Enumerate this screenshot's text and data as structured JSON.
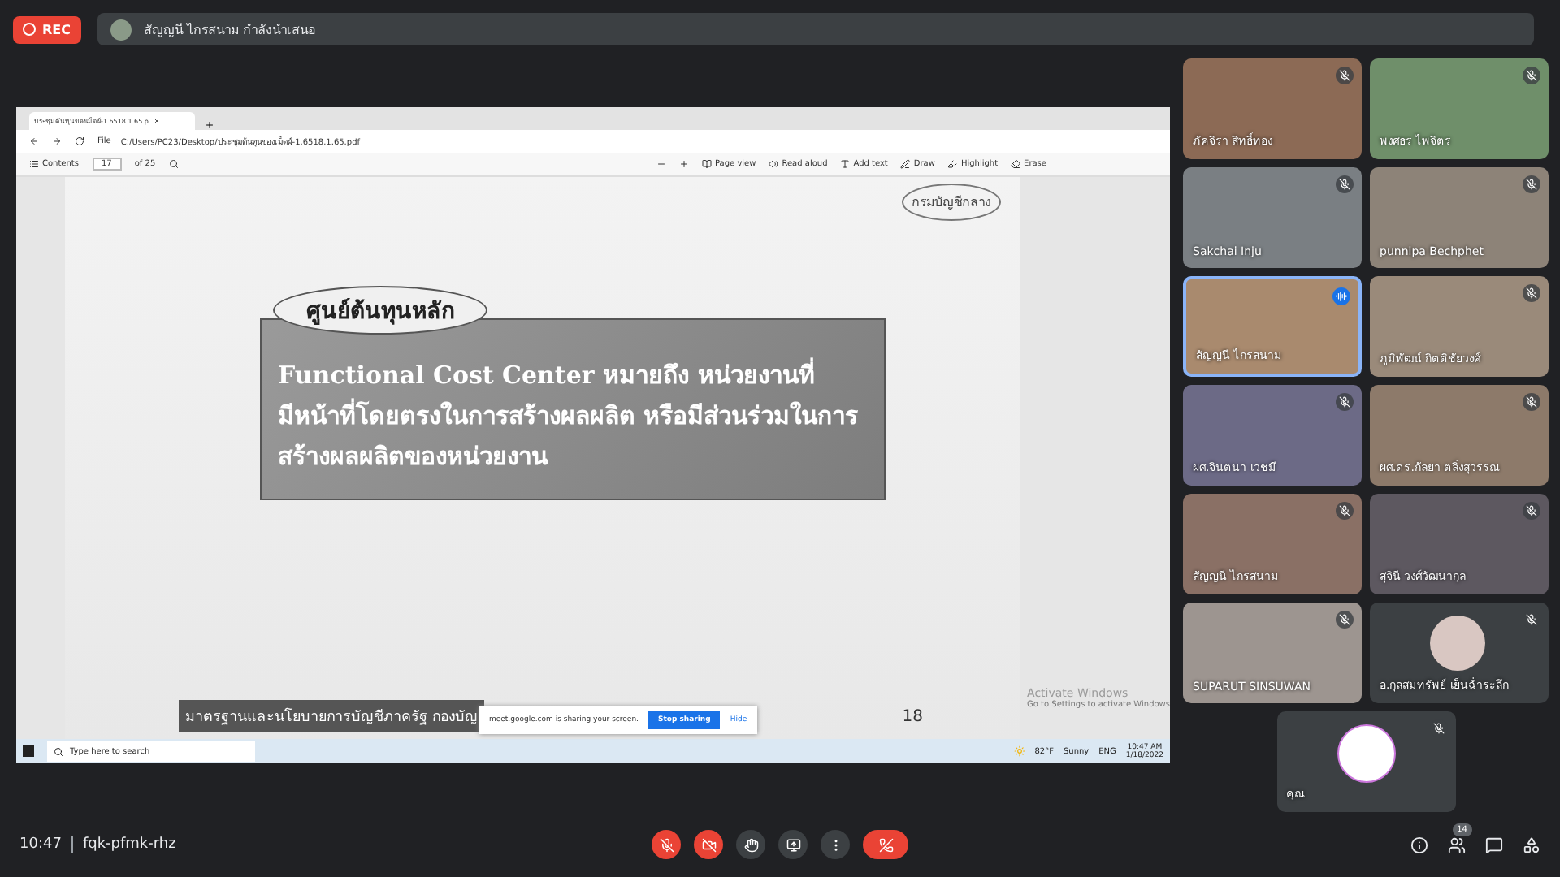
{
  "top_bar": {
    "rec_label": "REC",
    "presenter": "สัญญนี ไกรสนาม กำลังนำเสนอ"
  },
  "shared_screen": {
    "browser": {
      "tab_title": "ประชุมต้นทุนของเม็ดผ์-1.6518.1.65.p",
      "address_label": "File",
      "address": "C:/Users/PC23/Desktop/ประชุมต้นทุนของเม็ดผ์-1.6518.1.65.pdf"
    },
    "pdf_toolbar": {
      "contents": "Contents",
      "page": "17",
      "page_total": "of 25",
      "tools": [
        {
          "kind": "page",
          "label": "Page view"
        },
        {
          "kind": "read",
          "label": "Read aloud"
        },
        {
          "kind": "text",
          "label": "Add text"
        },
        {
          "kind": "draw",
          "label": "Draw"
        },
        {
          "kind": "highlight",
          "label": "Highlight"
        },
        {
          "kind": "erase",
          "label": "Erase"
        }
      ]
    },
    "slide": {
      "stamp": "กรมบัญชีกลาง",
      "heading": "ศูนย์ต้นทุนหลัก",
      "body": "Functional Cost Center หมายถึง หน่วยงานที่มีหน้าที่โดยตรงในการสร้างผลผลิต หรือมีส่วนร่วมในการสร้างผลผลิตของหน่วยงาน",
      "footer": "มาตรฐานและนโยบายการบัญชีภาครัฐ กองบัญ",
      "page_number": "18"
    },
    "windows_notice": {
      "title": "Activate Windows",
      "subtitle": "Go to Settings to activate Windows"
    },
    "share_notice": {
      "text": "meet.google.com is sharing your screen.",
      "stop_button": "Stop sharing",
      "hide_button": "Hide"
    },
    "taskbar": {
      "search_placeholder": "Type here to search",
      "weather_temp": "82°F",
      "weather": "Sunny",
      "language": "ENG",
      "time": "10:47 AM",
      "date": "1/18/2022"
    }
  },
  "participants": [
    {
      "kind": "video",
      "name": "ภัคจิรา สิทธิ์ทอง",
      "muted": true,
      "speaking": false
    },
    {
      "kind": "video",
      "name": "พงศธร ไพจิตร",
      "muted": true,
      "speaking": false
    },
    {
      "kind": "video",
      "name": "Sakchai Inju",
      "muted": true,
      "speaking": false
    },
    {
      "kind": "video",
      "name": "punnipa Bechphet",
      "muted": true,
      "speaking": false
    },
    {
      "kind": "video",
      "name": "สัญญนี ไกรสนาม",
      "muted": false,
      "speaking": true
    },
    {
      "kind": "video",
      "name": "ภูมิพัฒน์ กิตติชัยวงศ์",
      "muted": true,
      "speaking": false
    },
    {
      "kind": "video",
      "name": "ผศ.จินตนา เวชมี",
      "muted": true,
      "speaking": false
    },
    {
      "kind": "video",
      "name": "ผศ.ดร.กัลยา ตลิ่งสุวรรณ",
      "muted": true,
      "speaking": false
    },
    {
      "kind": "video",
      "name": "สัญญนี ไกรสนาม",
      "muted": true,
      "speaking": false
    },
    {
      "kind": "video",
      "name": "สุจินี วงศ์วัฒนากุล",
      "muted": true,
      "speaking": false
    },
    {
      "kind": "video",
      "name": "SUPARUT SINSUWAN",
      "muted": true,
      "speaking": false
    },
    {
      "kind": "avatar",
      "name": "อ.กุลสมทรัพย์ เย็นฉ่ำระลึก",
      "muted": true,
      "speaking": false
    },
    {
      "kind": "logo",
      "name": "คุณ",
      "muted": true,
      "speaking": false
    }
  ],
  "bottom_bar": {
    "time": "10:47",
    "meeting_code": "fqk-pfmk-rhz",
    "mic_on": false,
    "camera_on": false,
    "people_count": "14"
  }
}
